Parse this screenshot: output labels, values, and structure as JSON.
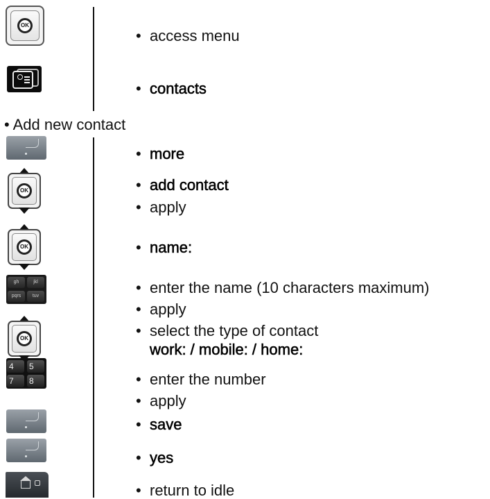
{
  "icons": {
    "ok_label": "OK",
    "keypad_keys": [
      "gh",
      "jkl",
      "pqrs",
      "tuv"
    ],
    "numpad_keys": [
      "4",
      "5",
      "7",
      "8"
    ]
  },
  "steps": {
    "access_menu": "access menu",
    "contacts": "contacts",
    "section_title": "• Add new contact",
    "more": "more",
    "add_contact": "add contact",
    "apply_1": "apply",
    "name": "name:",
    "enter_name": "enter the name (10 characters maximum)",
    "apply_2": "apply",
    "select_type": "select the type of contact",
    "types": "work: / mobile: / home:",
    "enter_number": "enter the number",
    "apply_3": "apply",
    "save": "save",
    "yes": "yes",
    "return_idle": "return to idle"
  },
  "bullet": "•"
}
